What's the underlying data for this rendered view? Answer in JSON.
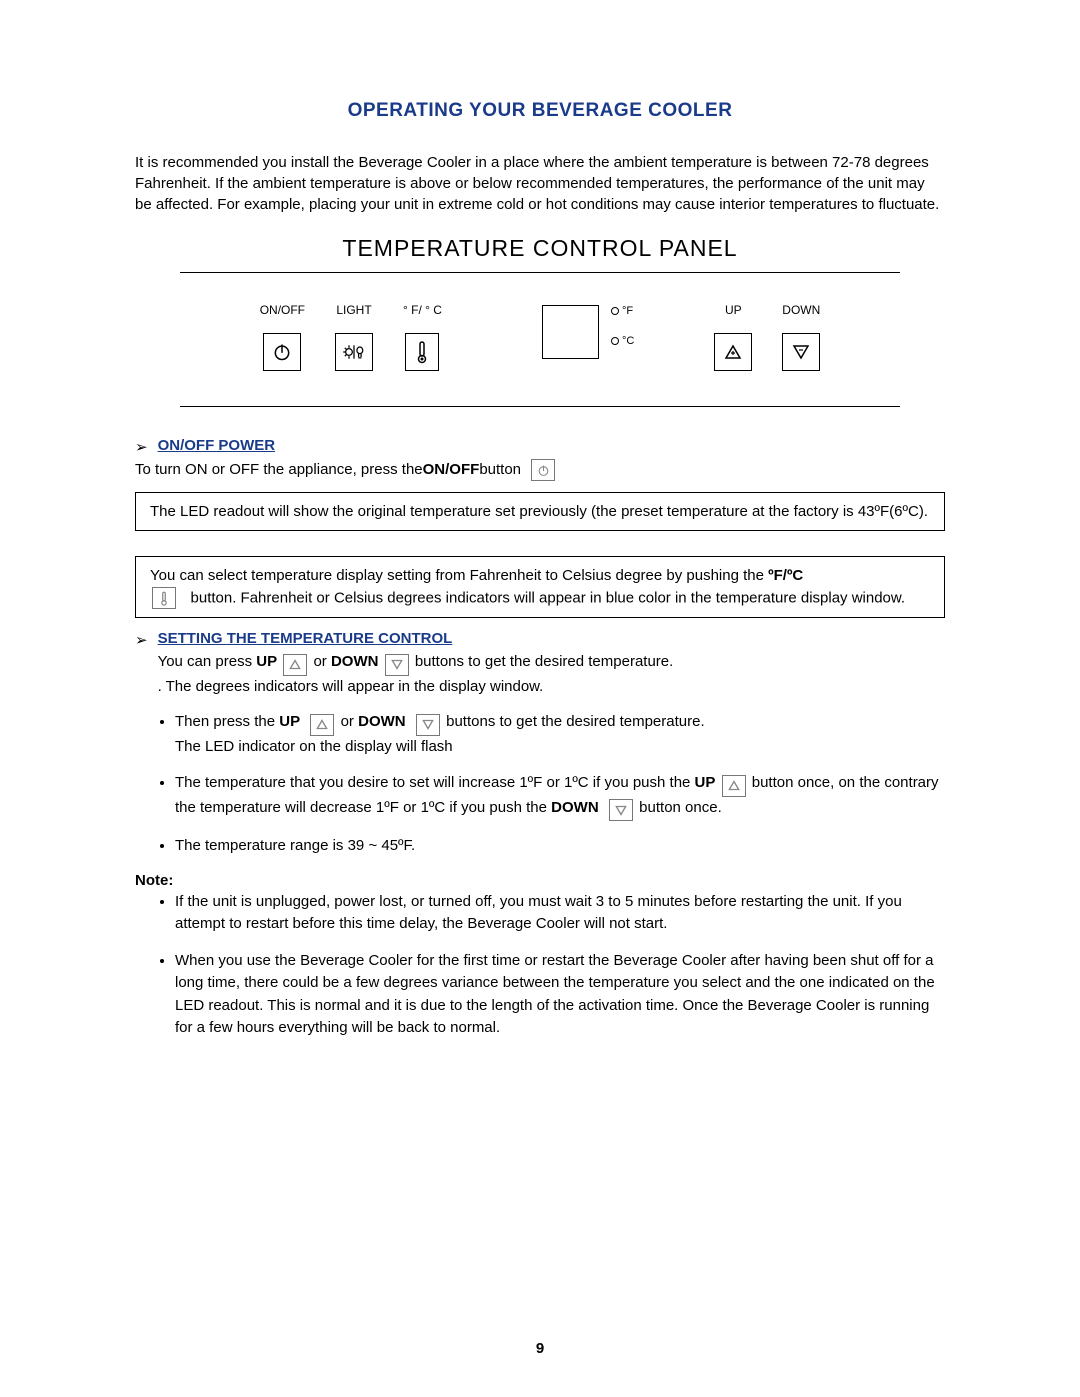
{
  "title": "OPERATING YOUR BEVERAGE COOLER",
  "intro": "It is recommended you install the Beverage Cooler in a place where the ambient temperature is between 72-78 degrees Fahrenheit.  If the ambient temperature is above or below recommended temperatures, the performance of the unit may be affected.  For example, placing your unit in extreme cold or hot conditions may cause interior temperatures to fluctuate.",
  "subtitle": "TEMPERATURE CONTROL PANEL",
  "panel": {
    "onoff": "ON/OFF",
    "light": "LIGHT",
    "fc": "° F/ ° C",
    "of": "°F",
    "oc": "°C",
    "up": "UP",
    "down": "DOWN"
  },
  "sections": {
    "onoff_head": "ON/OFF POWER",
    "onoff_text_a": "To turn ON or OFF the appliance, press the ",
    "onoff_bold": "ON/OFF",
    "onoff_text_b": " button",
    "led_note": "The LED readout will show the original temperature set previously (the preset temperature at the factory is 43ºF(6ºC).",
    "fc_note_a": "You can select temperature display setting from Fahrenheit to Celsius degree by pushing the ",
    "fc_bold": "ºF/ºC",
    "fc_note_b": "button.  Fahrenheit or Celsius degrees indicators will appear in blue color in the temperature display window.",
    "set_head": "SETTING THE TEMPERATURE CONTROL",
    "set_line1_a": "You can press ",
    "up_b": "UP",
    "set_line1_b": "  or ",
    "down_b": "DOWN",
    "set_line1_c": " buttons to get the desired temperature.",
    "set_line2": ". The degrees indicators will appear in the display window.",
    "bul1_a": "Then press the ",
    "bul1_b": " or ",
    "bul1_c": "  buttons to get the desired temperature.",
    "bul1_d": "The LED indicator on the display will flash",
    "bul2_a": "The temperature that you desire to set will increase 1ºF or 1ºC if you push the ",
    "bul2_b": "  button once, on the contrary the temperature will decrease 1ºF or 1ºC if you push the ",
    "bul2_c": "  button once.",
    "bul3": "The temperature range is 39 ~ 45ºF.",
    "note_label": "Note:",
    "note1": "If the unit is unplugged, power lost, or turned off, you must wait 3 to 5 minutes before restarting the unit. If you attempt to restart before this time delay, the Beverage Cooler will not start.",
    "note2": "When you use the Beverage Cooler for the first time or restart the Beverage Cooler after having been shut off for a long time, there could be a few degrees variance between the temperature you select and the one indicated on the LED readout.  This is normal and it is due to the length of the activation time. Once the Beverage Cooler is running for a few hours everything will be back to normal."
  },
  "page_number": "9"
}
